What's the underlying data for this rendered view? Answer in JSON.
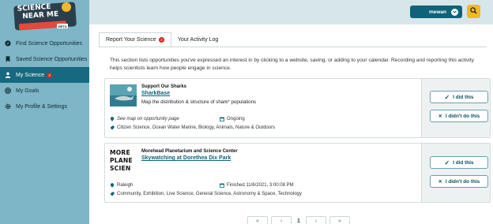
{
  "logo": {
    "line1": "SCIENCE",
    "line2": "NEAR ME",
    "beta": "BETA"
  },
  "sidebar": {
    "items": [
      {
        "label": "Find Science Opportunities",
        "icon": "compass-icon"
      },
      {
        "label": "Saved Science Opportunities",
        "icon": "bookmark-icon"
      },
      {
        "label": "My Science",
        "icon": "person-icon",
        "badge": "3",
        "active": true
      },
      {
        "label": "My Goals",
        "icon": "target-icon"
      },
      {
        "label": "My Profile & Settings",
        "icon": "gear-icon"
      }
    ]
  },
  "header": {
    "user": "mewan",
    "search_icon": "search-icon"
  },
  "tabs": [
    {
      "label": "Report Your Science",
      "badge": "3",
      "active": true
    },
    {
      "label": "Your Activity Log"
    }
  ],
  "intro": "This section lists opportunities you've expressed an interest in by clicking to a website, saving, or adding to your calendar. Recording and reporting this activity helps scientists learn how people engage in science.",
  "cards": [
    {
      "org": "Support Our Sharks",
      "title": "SharkBase",
      "description": "Map the distribution & structure of shark* populations",
      "location": "See map on opportunity page",
      "when": "Ongoing",
      "tags": "Citizen Science, Ocean Water Marine, Biology, Animals, Nature & Outdoors",
      "did_label": "I did this",
      "didnt_label": "I didn't do this"
    },
    {
      "org": "Morehead Planetarium and Science Center",
      "title": "Skywatching at Dorethea Dix Park",
      "logo_lines": [
        "MORE",
        "PLANE",
        "SCIEN"
      ],
      "location": "Raleigh",
      "when": "Finished 11/6/2021, 3:00:08 PM",
      "tags": "Community, Exhibition, Live Science, General Science, Astronomy & Space, Technology",
      "did_label": "I did this",
      "didnt_label": "I didn't do this"
    }
  ],
  "pager": {
    "first": "«",
    "prev": "‹",
    "current": "1",
    "next": "›",
    "last": "»"
  },
  "colors": {
    "sidebar": "#7fb6c7",
    "active": "#16697f",
    "header": "#d7e6eb",
    "accent": "#f4b728",
    "link": "#0f6378"
  }
}
